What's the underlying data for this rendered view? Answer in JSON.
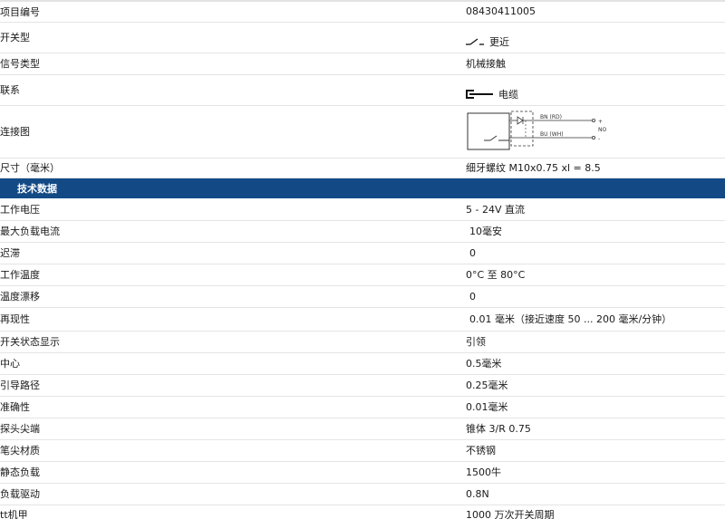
{
  "rows_top": [
    {
      "label": "项目编号",
      "value": "08430411005"
    },
    {
      "label": "开关型",
      "value": "更近",
      "icon": "switch-symbol-icon"
    },
    {
      "label": "信号类型",
      "value": "机械接触"
    },
    {
      "label": "联系",
      "value": "电缆",
      "icon": "cable-connector-icon"
    },
    {
      "label": "连接图",
      "diagram": {
        "wire1": "BN (RD)",
        "wire2": "BU (WH)",
        "plus": "+",
        "minus": "-",
        "contact": "NO"
      }
    },
    {
      "label": "尺寸（毫米）",
      "value": "细牙螺纹 M10x0.75 xl = 8.5"
    }
  ],
  "section_title": "技术数据",
  "rows_tech": [
    {
      "label": "工作电压",
      "value": "5 - 24V 直流"
    },
    {
      "label": "最大负载电流",
      "value": "10毫安"
    },
    {
      "label": "迟滞",
      "value": "0"
    },
    {
      "label": "工作温度",
      "value": "0°C 至 80°C"
    },
    {
      "label": "温度漂移",
      "value": "0"
    },
    {
      "label": "再现性",
      "value": "0.01 毫米（接近速度 50 ... 200 毫米/分钟）"
    },
    {
      "label": "开关状态显示",
      "value": "引领"
    },
    {
      "label": "中心",
      "value": "0.5毫米"
    },
    {
      "label": "引导路径",
      "value": "0.25毫米"
    },
    {
      "label": "准确性",
      "value": "0.01毫米"
    },
    {
      "label": "探头尖端",
      "value": "锥体 3/R 0.75"
    },
    {
      "label": "笔尖材质",
      "value": "不锈钢"
    },
    {
      "label": "静态负载",
      "value": "1500牛"
    },
    {
      "label": "负载驱动",
      "value": "0.8N"
    },
    {
      "label": "tt机甲",
      "value": "1000 万次开关周期"
    }
  ],
  "colors": {
    "section_bg": "#134a86",
    "section_text": "#ffffff",
    "row_border": "#e4e4e4"
  }
}
